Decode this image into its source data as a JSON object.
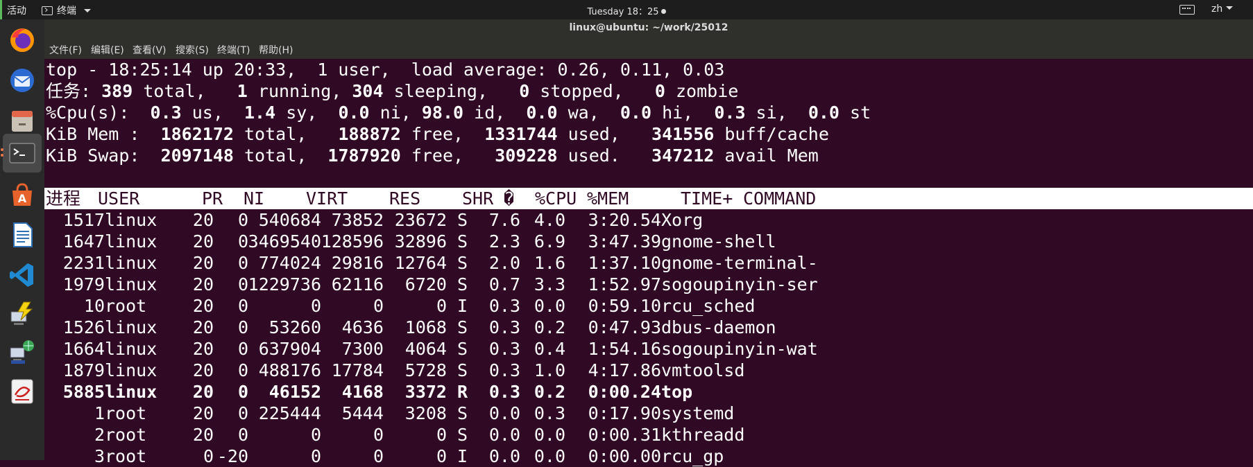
{
  "topbar": {
    "activities": "活动",
    "app_menu": "终端",
    "clock": "Tuesday 18：25",
    "lang": "zh"
  },
  "dock": {
    "icons": [
      "firefox-icon",
      "thunderbird-icon",
      "files-icon",
      "terminal-icon",
      "software-center-icon",
      "writer-icon",
      "vscode-icon",
      "network-tool-icon",
      "network-globe-icon",
      "document-viewer-icon"
    ]
  },
  "window": {
    "title": "linux@ubuntu: ~/work/25012",
    "menu": [
      "文件(F)",
      "编辑(E)",
      "查看(V)",
      "搜索(S)",
      "终端(T)",
      "帮助(H)"
    ]
  },
  "summary": {
    "line1": "top - 18:25:14 up 20:33,  1 user,  load average: 0.26, 0.11, 0.03",
    "tasks": [
      {
        "t": "任务: ",
        "b": false
      },
      {
        "t": "389",
        "b": true
      },
      {
        "t": " total,   ",
        "b": false
      },
      {
        "t": "1",
        "b": true
      },
      {
        "t": " running, ",
        "b": false
      },
      {
        "t": "304",
        "b": true
      },
      {
        "t": " sleeping,   ",
        "b": false
      },
      {
        "t": "0",
        "b": true
      },
      {
        "t": " stopped,   ",
        "b": false
      },
      {
        "t": "0",
        "b": true
      },
      {
        "t": " zombie",
        "b": false
      }
    ],
    "cpu": [
      {
        "t": "%Cpu(s):  ",
        "b": false
      },
      {
        "t": "0.3",
        "b": true
      },
      {
        "t": " us,  ",
        "b": false
      },
      {
        "t": "1.4",
        "b": true
      },
      {
        "t": " sy,  ",
        "b": false
      },
      {
        "t": "0.0",
        "b": true
      },
      {
        "t": " ni, ",
        "b": false
      },
      {
        "t": "98.0",
        "b": true
      },
      {
        "t": " id,  ",
        "b": false
      },
      {
        "t": "0.0",
        "b": true
      },
      {
        "t": " wa,  ",
        "b": false
      },
      {
        "t": "0.0",
        "b": true
      },
      {
        "t": " hi,  ",
        "b": false
      },
      {
        "t": "0.3",
        "b": true
      },
      {
        "t": " si,  ",
        "b": false
      },
      {
        "t": "0.0",
        "b": true
      },
      {
        "t": " st",
        "b": false
      }
    ],
    "mem": [
      {
        "t": "KiB Mem :  ",
        "b": false
      },
      {
        "t": "1862172",
        "b": true
      },
      {
        "t": " total,   ",
        "b": false
      },
      {
        "t": "188872",
        "b": true
      },
      {
        "t": " free,  ",
        "b": false
      },
      {
        "t": "1331744",
        "b": true
      },
      {
        "t": " used,   ",
        "b": false
      },
      {
        "t": "341556",
        "b": true
      },
      {
        "t": " buff/cache",
        "b": false
      }
    ],
    "swap": [
      {
        "t": "KiB Swap:  ",
        "b": false
      },
      {
        "t": "2097148",
        "b": true
      },
      {
        "t": " total,  ",
        "b": false
      },
      {
        "t": "1787920",
        "b": true
      },
      {
        "t": " free,   ",
        "b": false
      },
      {
        "t": "309228",
        "b": true
      },
      {
        "t": " used.   ",
        "b": false
      },
      {
        "t": "347212",
        "b": true
      },
      {
        "t": " avail Mem",
        "b": false
      }
    ]
  },
  "table": {
    "headers": [
      "进程",
      "USER",
      "PR",
      "NI",
      "VIRT",
      "RES",
      "SHR",
      "�",
      "%CPU",
      "%MEM",
      "TIME+",
      "COMMAND"
    ],
    "rows": [
      [
        "1517",
        "linux",
        "20",
        "0",
        "540684",
        "73852",
        "23672",
        "S",
        "7.6",
        "4.0",
        "3:20.54",
        "Xorg",
        false
      ],
      [
        "1647",
        "linux",
        "20",
        "0",
        "3469540",
        "128596",
        "32896",
        "S",
        "2.3",
        "6.9",
        "3:47.39",
        "gnome-shell",
        false
      ],
      [
        "2231",
        "linux",
        "20",
        "0",
        "774024",
        "29816",
        "12764",
        "S",
        "2.0",
        "1.6",
        "1:37.10",
        "gnome-terminal-",
        false
      ],
      [
        "1979",
        "linux",
        "20",
        "0",
        "1229736",
        "62116",
        "6720",
        "S",
        "0.7",
        "3.3",
        "1:52.97",
        "sogoupinyin-ser",
        false
      ],
      [
        "10",
        "root",
        "20",
        "0",
        "0",
        "0",
        "0",
        "I",
        "0.3",
        "0.0",
        "0:59.10",
        "rcu_sched",
        false
      ],
      [
        "1526",
        "linux",
        "20",
        "0",
        "53260",
        "4636",
        "1068",
        "S",
        "0.3",
        "0.2",
        "0:47.93",
        "dbus-daemon",
        false
      ],
      [
        "1664",
        "linux",
        "20",
        "0",
        "637904",
        "7300",
        "4064",
        "S",
        "0.3",
        "0.4",
        "1:54.16",
        "sogoupinyin-wat",
        false
      ],
      [
        "1879",
        "linux",
        "20",
        "0",
        "488176",
        "17784",
        "5728",
        "S",
        "0.3",
        "1.0",
        "4:17.86",
        "vmtoolsd",
        false
      ],
      [
        "5885",
        "linux",
        "20",
        "0",
        "46152",
        "4168",
        "3372",
        "R",
        "0.3",
        "0.2",
        "0:00.24",
        "top",
        true
      ],
      [
        "1",
        "root",
        "20",
        "0",
        "225444",
        "5444",
        "3208",
        "S",
        "0.0",
        "0.3",
        "0:17.90",
        "systemd",
        false
      ],
      [
        "2",
        "root",
        "20",
        "0",
        "0",
        "0",
        "0",
        "S",
        "0.0",
        "0.0",
        "0:00.31",
        "kthreadd",
        false
      ],
      [
        "3",
        "root",
        "0",
        "-20",
        "0",
        "0",
        "0",
        "I",
        "0.0",
        "0.0",
        "0:00.00",
        "rcu_gp",
        false
      ]
    ]
  }
}
